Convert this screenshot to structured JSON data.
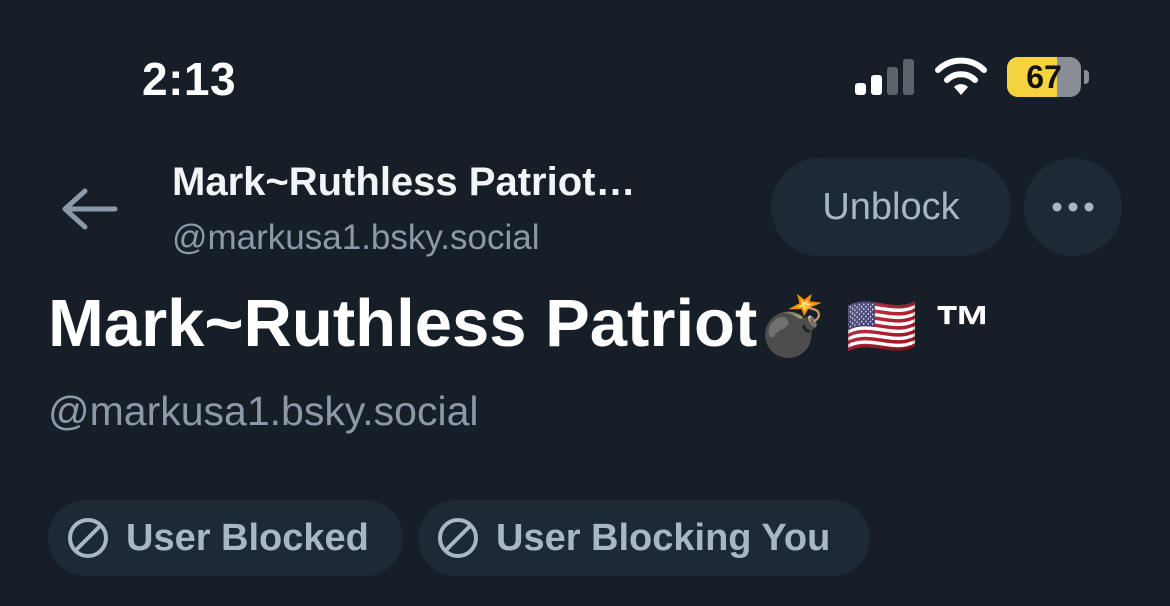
{
  "status_bar": {
    "time": "2:13",
    "signal_bars_active": 2,
    "signal_bars_total": 4,
    "battery_percent": "67",
    "battery_level": 0.67,
    "icons": [
      "signal-icon",
      "wifi-icon",
      "battery-icon"
    ]
  },
  "header": {
    "back_icon": "back-arrow-icon",
    "name": "Mark~Ruthless Patriot…",
    "handle": "@markusa1.bsky.social",
    "unblock_label": "Unblock",
    "more_icon": "ellipsis-icon"
  },
  "profile": {
    "name": "Mark~Ruthless Patriot",
    "name_suffix": "💣 🇺🇸 ™",
    "handle": "@markusa1.bsky.social"
  },
  "moderation": {
    "pills": [
      {
        "label": "User Blocked",
        "icon": "ban-icon"
      },
      {
        "label": "User Blocking You",
        "icon": "ban-icon"
      }
    ]
  },
  "colors": {
    "background": "#161e27",
    "pill_background": "#1e2936",
    "muted_text": "#8c99a8",
    "pill_text": "#a9b6c4",
    "battery_fill": "#f5d33f"
  }
}
